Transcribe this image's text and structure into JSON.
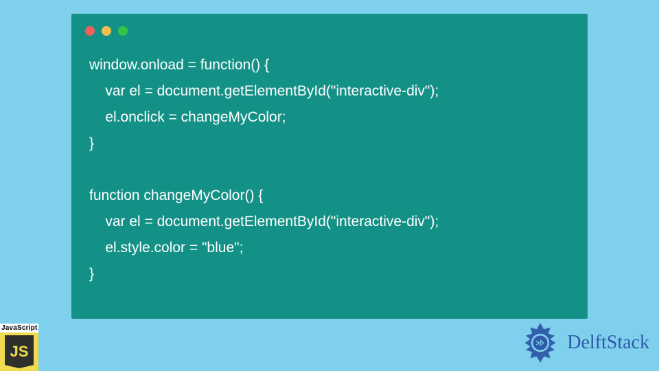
{
  "code": {
    "lines": [
      "window.onload = function() {",
      "    var el = document.getElementById(\"interactive-div\");",
      "    el.onclick = changeMyColor;",
      "}",
      "",
      "function changeMyColor() {",
      "    var el = document.getElementById(\"interactive-div\");",
      "    el.style.color = \"blue\";",
      "}"
    ]
  },
  "badges": {
    "js_label": "JavaScript",
    "js_logo_text": "JS",
    "delft_text": "DelftStack"
  },
  "colors": {
    "background": "#7fd0ed",
    "window": "#149187",
    "code_text": "#ffffff",
    "js_yellow": "#f0db4f",
    "delft_blue": "#2e5aa8"
  }
}
